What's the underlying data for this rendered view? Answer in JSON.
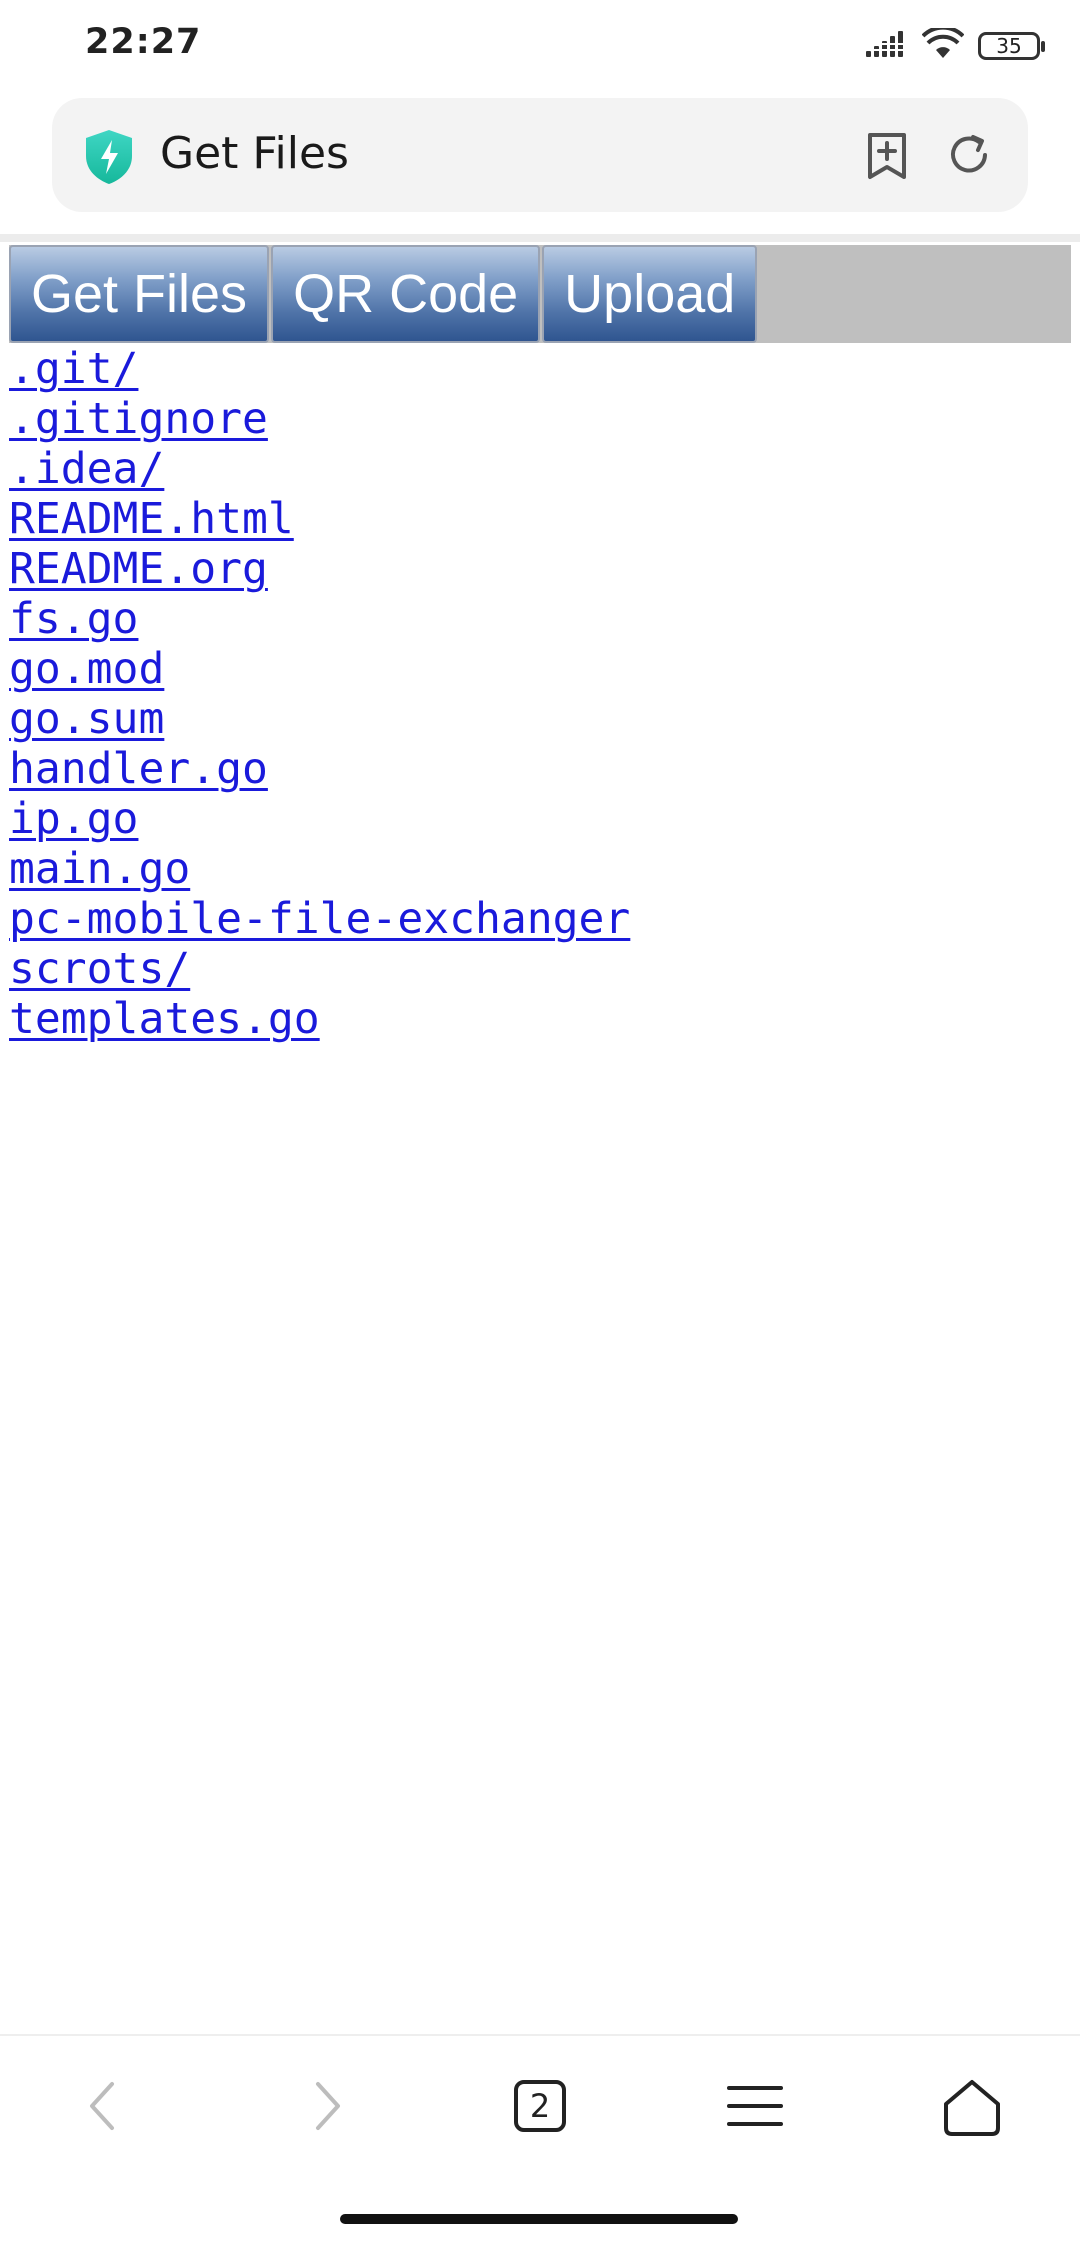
{
  "status_bar": {
    "time": "22:27",
    "battery": "35",
    "icons": [
      "signal-icon",
      "wifi-icon",
      "battery-icon"
    ]
  },
  "browser": {
    "address_title": "Get Files",
    "icons": [
      "shield-icon",
      "bookmark-add-icon",
      "reload-icon"
    ]
  },
  "page": {
    "nav": [
      {
        "label": "Get Files"
      },
      {
        "label": "QR Code"
      },
      {
        "label": "Upload"
      }
    ],
    "files": [
      ".git/",
      ".gitignore",
      ".idea/",
      "README.html",
      "README.org",
      "fs.go",
      "go.mod",
      "go.sum",
      "handler.go",
      "ip.go",
      "main.go",
      "pc-mobile-file-exchanger",
      "scrots/",
      "templates.go"
    ],
    "link_color": "#1a1adb"
  },
  "toolbar": {
    "tabs_count": "2",
    "icons": [
      "back-icon",
      "forward-icon",
      "tabs-icon",
      "menu-icon",
      "home-icon"
    ]
  }
}
